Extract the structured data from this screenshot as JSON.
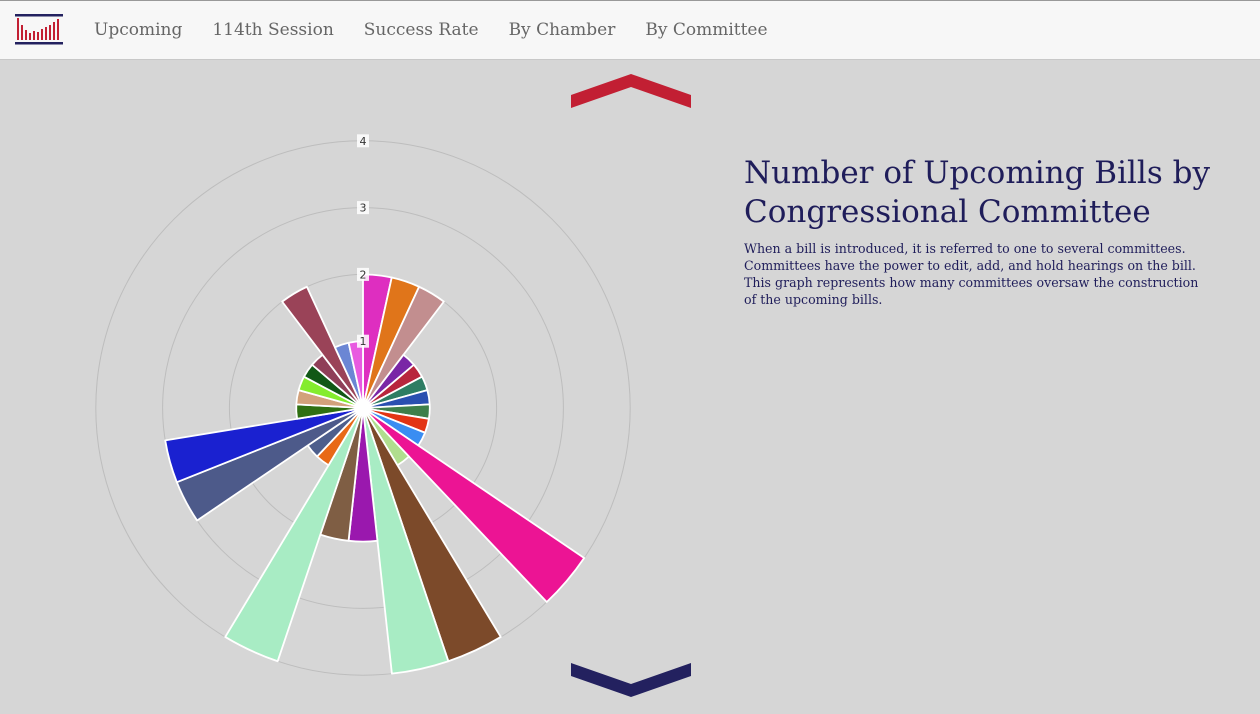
{
  "nav": {
    "items": [
      {
        "label": "Upcoming"
      },
      {
        "label": "114th Session"
      },
      {
        "label": "Success Rate"
      },
      {
        "label": "By Chamber"
      },
      {
        "label": "By Committee"
      }
    ]
  },
  "colors": {
    "accent_red": "#c21f33",
    "accent_navy": "#23215f",
    "nav_text": "#666666",
    "heading_text": "#1f1d5a"
  },
  "icons": {
    "logo": "capitol-bar-chart-logo",
    "up": "chevron-up-icon",
    "down": "chevron-down-icon"
  },
  "info": {
    "title": "Number of Upcoming Bills by Congressional Committee",
    "description": "When a bill is introduced, it is referred to one to several committees. Committees have the power to edit, add, and hold hearings on the bill. This graph represents how many committees oversaw the construction of the upcoming bills."
  },
  "chart_data": {
    "type": "polar-area",
    "title": "",
    "radial_ticks": [
      1,
      2,
      3,
      4
    ],
    "radial_max": 4,
    "grid": true,
    "start_angle_deg": 0,
    "values": [
      2,
      2,
      2,
      1,
      1,
      1,
      1,
      1,
      1,
      1,
      4,
      1,
      4,
      4,
      2,
      2,
      4,
      1,
      1,
      3,
      3,
      1,
      1,
      1,
      1,
      1,
      2,
      1,
      1
    ],
    "colors": [
      "#de2ec0",
      "#e0751a",
      "#c28e8f",
      "#7a26a6",
      "#b8253d",
      "#2e7d63",
      "#2a4fb0",
      "#3e7f4a",
      "#e33414",
      "#3a8df2",
      "#ec1494",
      "#b0de8e",
      "#7c4a2a",
      "#a8ecc4",
      "#9a18ae",
      "#7f5e44",
      "#a8ecc4",
      "#e86916",
      "#4d5e8c",
      "#4d5a8a",
      "#1a21d0",
      "#2f6f12",
      "#d2a17b",
      "#84ec2e",
      "#115816",
      "#8f3f58",
      "#9a4358",
      "#6b86d4",
      "#e85ae0"
    ]
  }
}
